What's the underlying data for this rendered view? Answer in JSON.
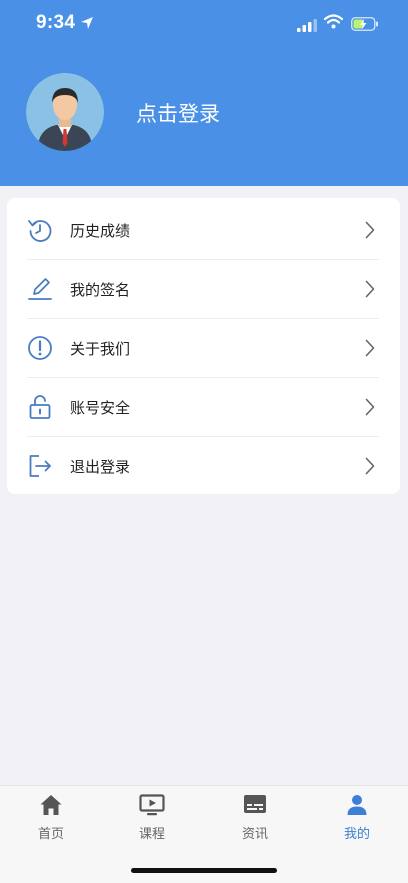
{
  "status_bar": {
    "time": "9:34",
    "icons": [
      "location-arrow-icon",
      "cellular-signal-icon",
      "wifi-icon",
      "battery-charging-icon"
    ]
  },
  "profile": {
    "login_prompt": "点击登录",
    "avatar_icon": "default-user-avatar"
  },
  "menu": {
    "items": [
      {
        "label": "历史成绩",
        "icon": "history-icon"
      },
      {
        "label": "我的签名",
        "icon": "pen-icon"
      },
      {
        "label": "关于我们",
        "icon": "info-exclamation-icon"
      },
      {
        "label": "账号安全",
        "icon": "unlock-icon"
      },
      {
        "label": "退出登录",
        "icon": "logout-icon"
      }
    ]
  },
  "tab_bar": {
    "tabs": [
      {
        "label": "首页",
        "icon": "home-icon",
        "active": false
      },
      {
        "label": "课程",
        "icon": "video-play-icon",
        "active": false
      },
      {
        "label": "资讯",
        "icon": "news-icon",
        "active": false
      },
      {
        "label": "我的",
        "icon": "person-icon",
        "active": true
      }
    ]
  },
  "colors": {
    "header_bg": "#4a90e6",
    "page_bg": "#f2f2f6",
    "icon_blue": "#4a7cc0",
    "tab_active": "#3d7fd4",
    "tab_inactive": "#555555"
  }
}
